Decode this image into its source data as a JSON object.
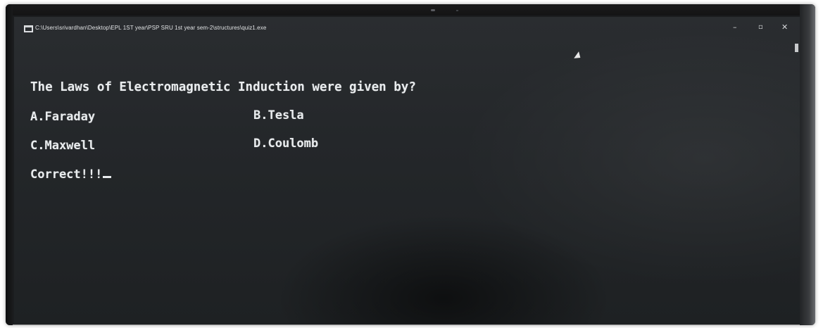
{
  "window": {
    "title": "C:\\Users\\srivardhan\\Desktop\\EPL 1ST year\\PSP SRU 1st year sem-2\\structures\\quiz1.exe",
    "minimize_glyph": "–",
    "maximize_glyph": "▫",
    "close_glyph": "✕"
  },
  "console": {
    "question": "The Laws of Electromagnetic Induction were given by?",
    "options": [
      "A.Faraday",
      "B.Tesla",
      "C.Maxwell",
      "D.Coulomb"
    ],
    "result": "Correct!!!"
  },
  "icons": {
    "console_app": "console-window-icon",
    "mouse": "mouse-pointer-icon"
  },
  "colors": {
    "console_background": "#24272a",
    "console_text": "#e9ecee"
  }
}
